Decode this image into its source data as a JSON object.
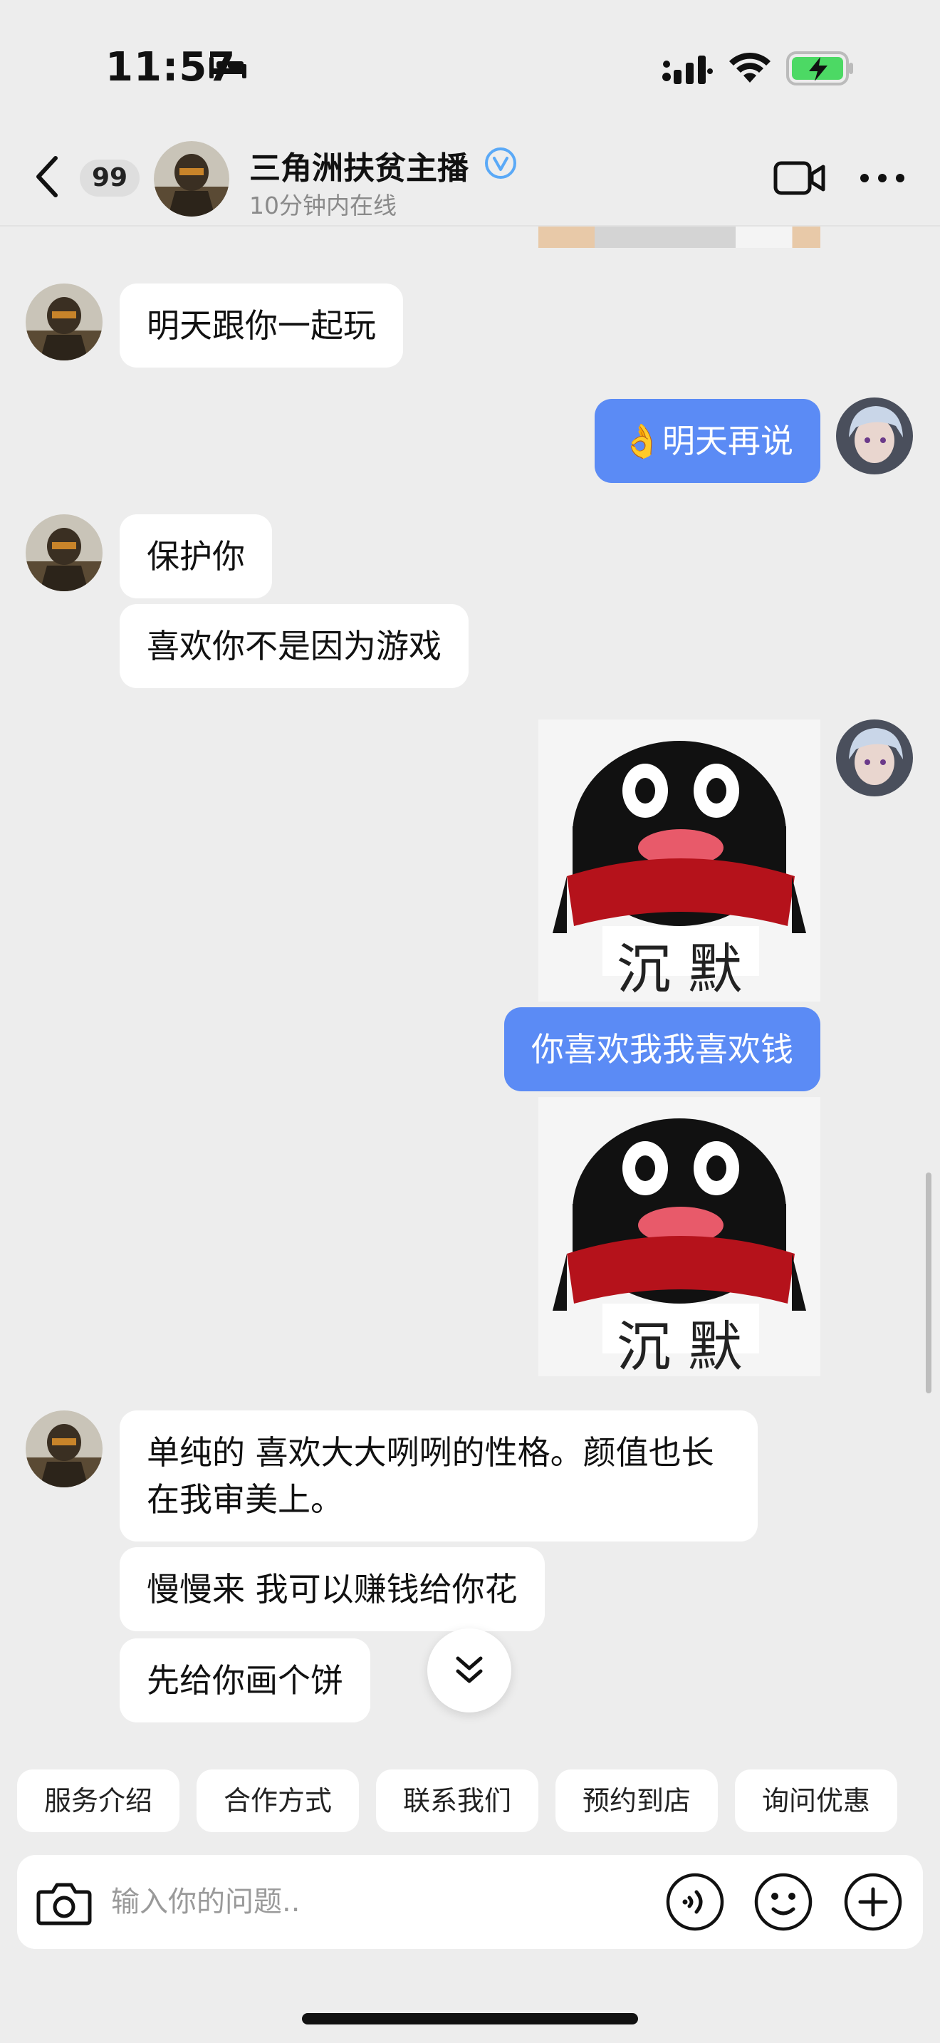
{
  "status": {
    "time": "11:57"
  },
  "header": {
    "back_badge": "99",
    "name": "三角洲扶贫主播",
    "online": "10分钟内在线"
  },
  "messages": [
    {
      "from": "them",
      "text": "明天跟你一起玩"
    },
    {
      "from": "me",
      "text": "👌明天再说"
    },
    {
      "from": "them",
      "text": "保护你"
    },
    {
      "from": "them",
      "text": "喜欢你不是因为游戏"
    },
    {
      "from": "me",
      "type": "sticker",
      "caption": "沉 默"
    },
    {
      "from": "me",
      "text": "你喜欢我我喜欢钱"
    },
    {
      "from": "me",
      "type": "sticker",
      "caption": "沉 默"
    },
    {
      "from": "them",
      "text": "单纯的 喜欢大大咧咧的性格。颜值也长在我审美上。"
    },
    {
      "from": "them",
      "text": "慢慢来 我可以赚钱给你花"
    },
    {
      "from": "them",
      "text": "先给你画个饼"
    }
  ],
  "quick_replies": [
    "服务介绍",
    "合作方式",
    "联系我们",
    "预约到店",
    "询问优惠"
  ],
  "input": {
    "placeholder": "输入你的问题.."
  },
  "colors": {
    "outgoing_bubble": "#5b8bf5",
    "background": "#ededed",
    "battery": "#4cd964",
    "verified": "#5aa9f7"
  }
}
